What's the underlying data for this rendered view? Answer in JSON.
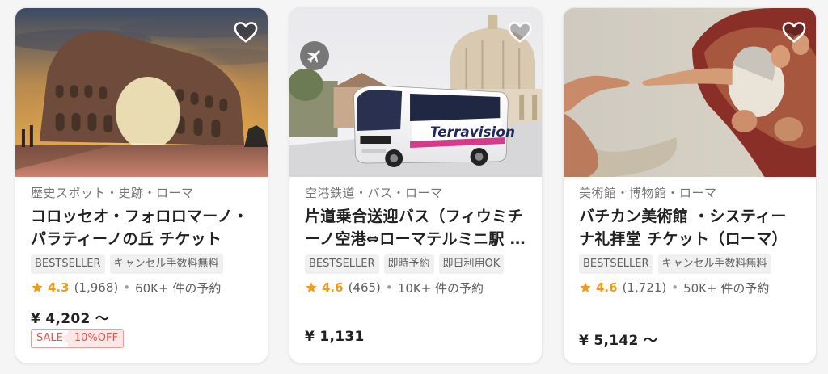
{
  "cards": [
    {
      "category": "歴史スポット・史跡・ローマ",
      "title": "コロッセオ・フォロロマーノ・パラティーノの丘 チケット",
      "tags": [
        "BESTSELLER",
        "キャンセル手数料無料"
      ],
      "score": "4.3",
      "count": "(1,968)",
      "booked": "60K+ 件の予約",
      "price": "¥ 4,202 〜",
      "sale_label": "SALE",
      "sale_off": "10%OFF",
      "icon": "heart-icon"
    },
    {
      "category": "空港鉄道・バス・ローマ",
      "title": "片道乗合送迎バス（フィウミチーノ空港⇔ローマテルミニ駅 / ...",
      "tags": [
        "BESTSELLER",
        "即時予約",
        "即日利用OK"
      ],
      "score": "4.6",
      "count": "(465)",
      "booked": "10K+ 件の予約",
      "price": "¥ 1,131",
      "bus_brand": "Terravision",
      "icon": "airplane-icon"
    },
    {
      "category": "美術館・博物館・ローマ",
      "title": "バチカン美術館 ・システィーナ礼拝堂 チケット（ローマ）",
      "tags": [
        "BESTSELLER",
        "キャンセル手数料無料"
      ],
      "score": "4.6",
      "count": "(1,721)",
      "booked": "50K+ 件の予約",
      "price": "¥ 5,142 〜",
      "icon": "heart-icon"
    }
  ],
  "colors": {
    "star": "#f09b1b",
    "sale": "#e5534b",
    "tag_bg": "#f0f0f0"
  }
}
